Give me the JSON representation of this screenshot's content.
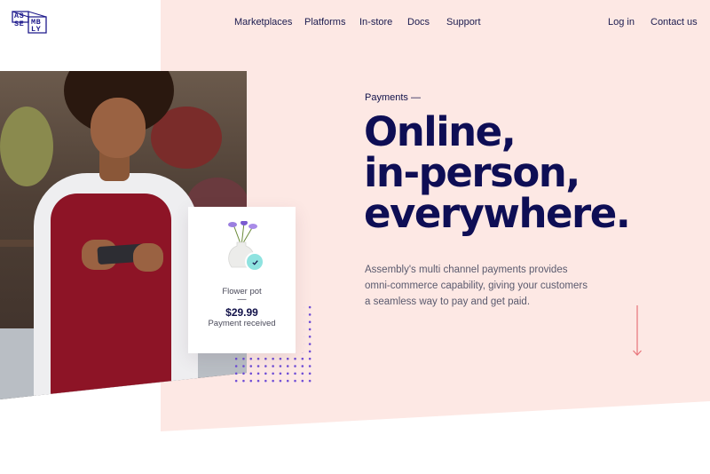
{
  "logo": {
    "letters": [
      "AS",
      "SE",
      "MB",
      "LY"
    ]
  },
  "nav": {
    "items": [
      "Marketplaces",
      "Platforms",
      "In-store",
      "Docs",
      "Support"
    ],
    "login": "Log in",
    "contact": "Contact us"
  },
  "hero": {
    "eyebrow": "Payments  —",
    "headline": [
      "Online,",
      "in-person,",
      "everywhere."
    ],
    "body": "Assembly's multi channel payments provides omni-commerce capability, giving your customers a seamless way to pay and get paid."
  },
  "card": {
    "name": "Flower pot",
    "dash": "—",
    "price": "$29.99",
    "status": "Payment received"
  },
  "colors": {
    "pink_panel": "#fde8e4",
    "navy": "#0e0e55",
    "logo": "#1e1a8c",
    "accent_dots": "#6d4bd6",
    "check": "#8fe3e0",
    "arrow": "#e8747a"
  },
  "icons": [
    "logo-icon",
    "check-icon",
    "down-arrow-icon",
    "dot-grid-decoration"
  ]
}
